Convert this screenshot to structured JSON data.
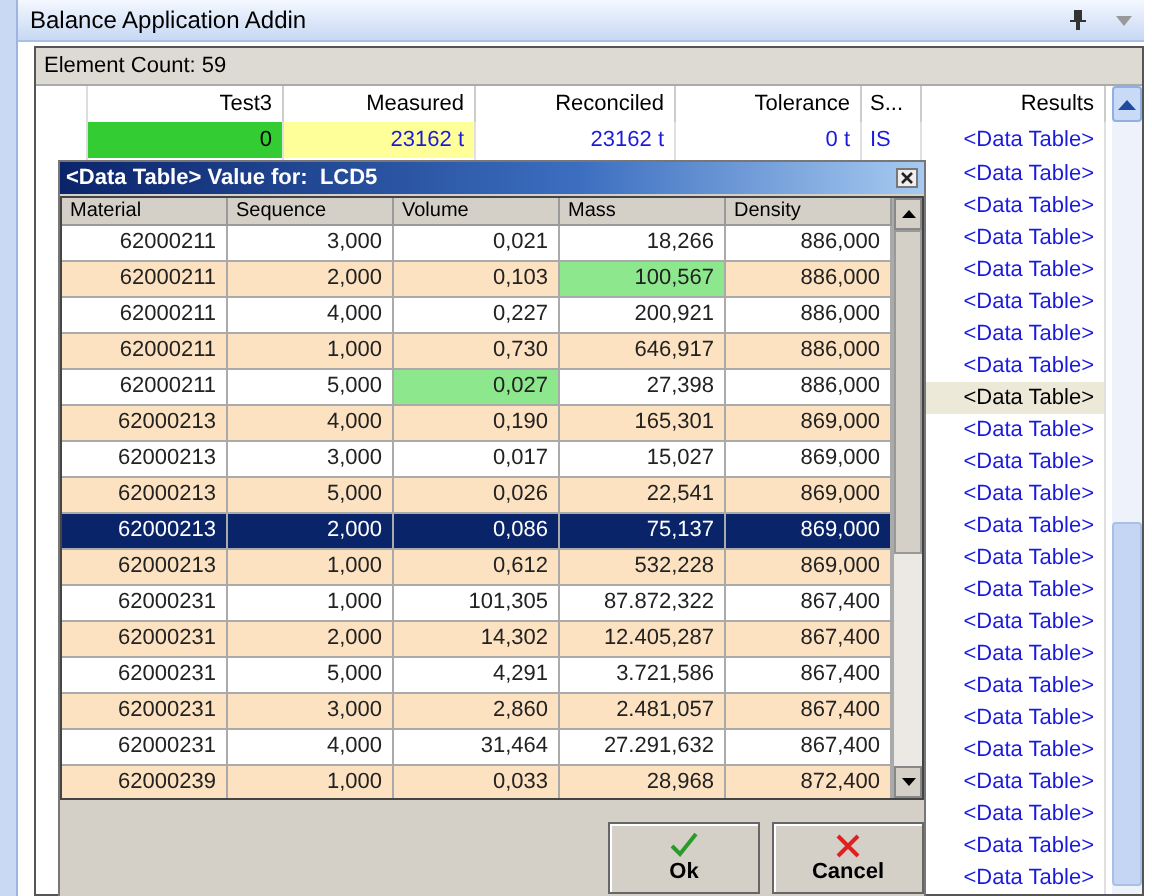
{
  "window": {
    "title": "Balance Application Addin"
  },
  "element_count": "Element Count: 59",
  "grid": {
    "columns": [
      "Test3",
      "Measured",
      "Reconciled",
      "Tolerance",
      "S...",
      "Results"
    ],
    "first_row": [
      {
        "text": "0",
        "color": "#33cc33"
      },
      {
        "text": "23162 t",
        "color": "#ffff99"
      },
      {
        "text": "23162 t",
        "color": "#ffffff"
      },
      {
        "text": "0 t",
        "color": "#ffffff"
      },
      {
        "text": "IS",
        "color": "#ffffff"
      },
      {
        "text": "<Data Table>",
        "color": "#ffffff"
      }
    ],
    "results": [
      {
        "text": "<Data Table>",
        "selected": false
      },
      {
        "text": "<Data Table>",
        "selected": false
      },
      {
        "text": "<Data Table>",
        "selected": false
      },
      {
        "text": "<Data Table>",
        "selected": false
      },
      {
        "text": "<Data Table>",
        "selected": false
      },
      {
        "text": "<Data Table>",
        "selected": false
      },
      {
        "text": "<Data Table>",
        "selected": false
      },
      {
        "text": "<Data Table>",
        "selected": true
      },
      {
        "text": "<Data Table>",
        "selected": false
      },
      {
        "text": "<Data Table>",
        "selected": false
      },
      {
        "text": "<Data Table>",
        "selected": false
      },
      {
        "text": "<Data Table>",
        "selected": false
      },
      {
        "text": "<Data Table>",
        "selected": false
      },
      {
        "text": "<Data Table>",
        "selected": false
      },
      {
        "text": "<Data Table>",
        "selected": false
      },
      {
        "text": "<Data Table>",
        "selected": false
      },
      {
        "text": "<Data Table>",
        "selected": false
      },
      {
        "text": "<Data Table>",
        "selected": false
      },
      {
        "text": "<Data Table>",
        "selected": false
      },
      {
        "text": "<Data Table>",
        "selected": false
      },
      {
        "text": "<Data Table>",
        "selected": false
      },
      {
        "text": "<Data Table>",
        "selected": false
      },
      {
        "text": "<Data Table>",
        "selected": false
      }
    ]
  },
  "dialog": {
    "title": "<Data Table> Value for:  LCD5",
    "columns": [
      "Material",
      "Sequence",
      "Volume",
      "Mass",
      "Density"
    ],
    "rows": [
      {
        "selected": false,
        "cells": [
          {
            "text": "62000211",
            "highlighted": false
          },
          {
            "text": "3,000",
            "highlighted": false
          },
          {
            "text": "0,021",
            "highlighted": false
          },
          {
            "text": "18,266",
            "highlighted": false
          },
          {
            "text": "886,000",
            "highlighted": false
          }
        ]
      },
      {
        "selected": false,
        "cells": [
          {
            "text": "62000211",
            "highlighted": false
          },
          {
            "text": "2,000",
            "highlighted": false
          },
          {
            "text": "0,103",
            "highlighted": false
          },
          {
            "text": "100,567",
            "highlighted": true
          },
          {
            "text": "886,000",
            "highlighted": false
          }
        ]
      },
      {
        "selected": false,
        "cells": [
          {
            "text": "62000211",
            "highlighted": false
          },
          {
            "text": "4,000",
            "highlighted": false
          },
          {
            "text": "0,227",
            "highlighted": false
          },
          {
            "text": "200,921",
            "highlighted": false
          },
          {
            "text": "886,000",
            "highlighted": false
          }
        ]
      },
      {
        "selected": false,
        "cells": [
          {
            "text": "62000211",
            "highlighted": false
          },
          {
            "text": "1,000",
            "highlighted": false
          },
          {
            "text": "0,730",
            "highlighted": false
          },
          {
            "text": "646,917",
            "highlighted": false
          },
          {
            "text": "886,000",
            "highlighted": false
          }
        ]
      },
      {
        "selected": false,
        "cells": [
          {
            "text": "62000211",
            "highlighted": false
          },
          {
            "text": "5,000",
            "highlighted": false
          },
          {
            "text": "0,027",
            "highlighted": true
          },
          {
            "text": "27,398",
            "highlighted": false
          },
          {
            "text": "886,000",
            "highlighted": false
          }
        ]
      },
      {
        "selected": false,
        "cells": [
          {
            "text": "62000213",
            "highlighted": false
          },
          {
            "text": "4,000",
            "highlighted": false
          },
          {
            "text": "0,190",
            "highlighted": false
          },
          {
            "text": "165,301",
            "highlighted": false
          },
          {
            "text": "869,000",
            "highlighted": false
          }
        ]
      },
      {
        "selected": false,
        "cells": [
          {
            "text": "62000213",
            "highlighted": false
          },
          {
            "text": "3,000",
            "highlighted": false
          },
          {
            "text": "0,017",
            "highlighted": false
          },
          {
            "text": "15,027",
            "highlighted": false
          },
          {
            "text": "869,000",
            "highlighted": false
          }
        ]
      },
      {
        "selected": false,
        "cells": [
          {
            "text": "62000213",
            "highlighted": false
          },
          {
            "text": "5,000",
            "highlighted": false
          },
          {
            "text": "0,026",
            "highlighted": false
          },
          {
            "text": "22,541",
            "highlighted": false
          },
          {
            "text": "869,000",
            "highlighted": false
          }
        ]
      },
      {
        "selected": true,
        "cells": [
          {
            "text": "62000213",
            "highlighted": false
          },
          {
            "text": "2,000",
            "highlighted": false
          },
          {
            "text": "0,086",
            "highlighted": false
          },
          {
            "text": "75,137",
            "highlighted": false
          },
          {
            "text": "869,000",
            "highlighted": false
          }
        ]
      },
      {
        "selected": false,
        "cells": [
          {
            "text": "62000213",
            "highlighted": false
          },
          {
            "text": "1,000",
            "highlighted": false
          },
          {
            "text": "0,612",
            "highlighted": false
          },
          {
            "text": "532,228",
            "highlighted": false
          },
          {
            "text": "869,000",
            "highlighted": false
          }
        ]
      },
      {
        "selected": false,
        "cells": [
          {
            "text": "62000231",
            "highlighted": false
          },
          {
            "text": "1,000",
            "highlighted": false
          },
          {
            "text": "101,305",
            "highlighted": false
          },
          {
            "text": "87.872,322",
            "highlighted": false
          },
          {
            "text": "867,400",
            "highlighted": false
          }
        ]
      },
      {
        "selected": false,
        "cells": [
          {
            "text": "62000231",
            "highlighted": false
          },
          {
            "text": "2,000",
            "highlighted": false
          },
          {
            "text": "14,302",
            "highlighted": false
          },
          {
            "text": "12.405,287",
            "highlighted": false
          },
          {
            "text": "867,400",
            "highlighted": false
          }
        ]
      },
      {
        "selected": false,
        "cells": [
          {
            "text": "62000231",
            "highlighted": false
          },
          {
            "text": "5,000",
            "highlighted": false
          },
          {
            "text": "4,291",
            "highlighted": false
          },
          {
            "text": "3.721,586",
            "highlighted": false
          },
          {
            "text": "867,400",
            "highlighted": false
          }
        ]
      },
      {
        "selected": false,
        "cells": [
          {
            "text": "62000231",
            "highlighted": false
          },
          {
            "text": "3,000",
            "highlighted": false
          },
          {
            "text": "2,860",
            "highlighted": false
          },
          {
            "text": "2.481,057",
            "highlighted": false
          },
          {
            "text": "867,400",
            "highlighted": false
          }
        ]
      },
      {
        "selected": false,
        "cells": [
          {
            "text": "62000231",
            "highlighted": false
          },
          {
            "text": "4,000",
            "highlighted": false
          },
          {
            "text": "31,464",
            "highlighted": false
          },
          {
            "text": "27.291,632",
            "highlighted": false
          },
          {
            "text": "867,400",
            "highlighted": false
          }
        ]
      },
      {
        "selected": false,
        "cells": [
          {
            "text": "62000239",
            "highlighted": false
          },
          {
            "text": "1,000",
            "highlighted": false
          },
          {
            "text": "0,033",
            "highlighted": false
          },
          {
            "text": "28,968",
            "highlighted": false
          },
          {
            "text": "872,400",
            "highlighted": false
          }
        ]
      }
    ],
    "buttons": [
      {
        "kind": "ok",
        "label": "Ok"
      },
      {
        "kind": "cancel",
        "label": "Cancel"
      }
    ]
  }
}
